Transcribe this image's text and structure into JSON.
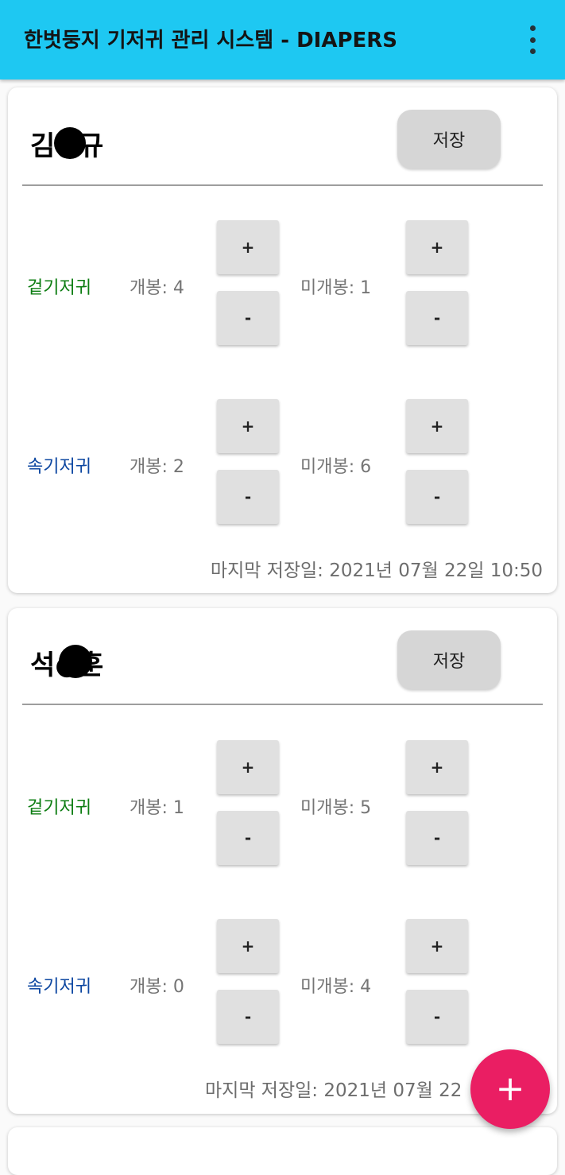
{
  "appbar": {
    "title": "한벗둥지 기저귀 관리 시스템 - DIAPERS",
    "menu_icon": "more-vert-icon"
  },
  "cards": [
    {
      "name": "김●규",
      "save_label": "저장",
      "rows": [
        {
          "type": "겉기저귀",
          "opened": "개봉: 4",
          "unopened": "미개봉: 1"
        },
        {
          "type": "속기저귀",
          "opened": "개봉: 2",
          "unopened": "미개봉: 6"
        }
      ],
      "last_saved": "마지막 저장일: 2021년 07월 22일 10:50"
    },
    {
      "name": "석●훈",
      "save_label": "저장",
      "rows": [
        {
          "type": "겉기저귀",
          "opened": "개봉: 1",
          "unopened": "미개봉: 5"
        },
        {
          "type": "속기저귀",
          "opened": "개봉: 0",
          "unopened": "미개봉: 4"
        }
      ],
      "last_saved": "마지막 저장일: 2021년 07월 22"
    }
  ],
  "buttons": {
    "plus": "+",
    "minus": "-"
  },
  "fab": {
    "label": "+",
    "icon": "add-icon"
  },
  "colors": {
    "appbar": "#1ec8f2",
    "outer_diaper": "#0d7d12",
    "inner_diaper": "#0d47a1",
    "fab": "#ea1e63"
  }
}
